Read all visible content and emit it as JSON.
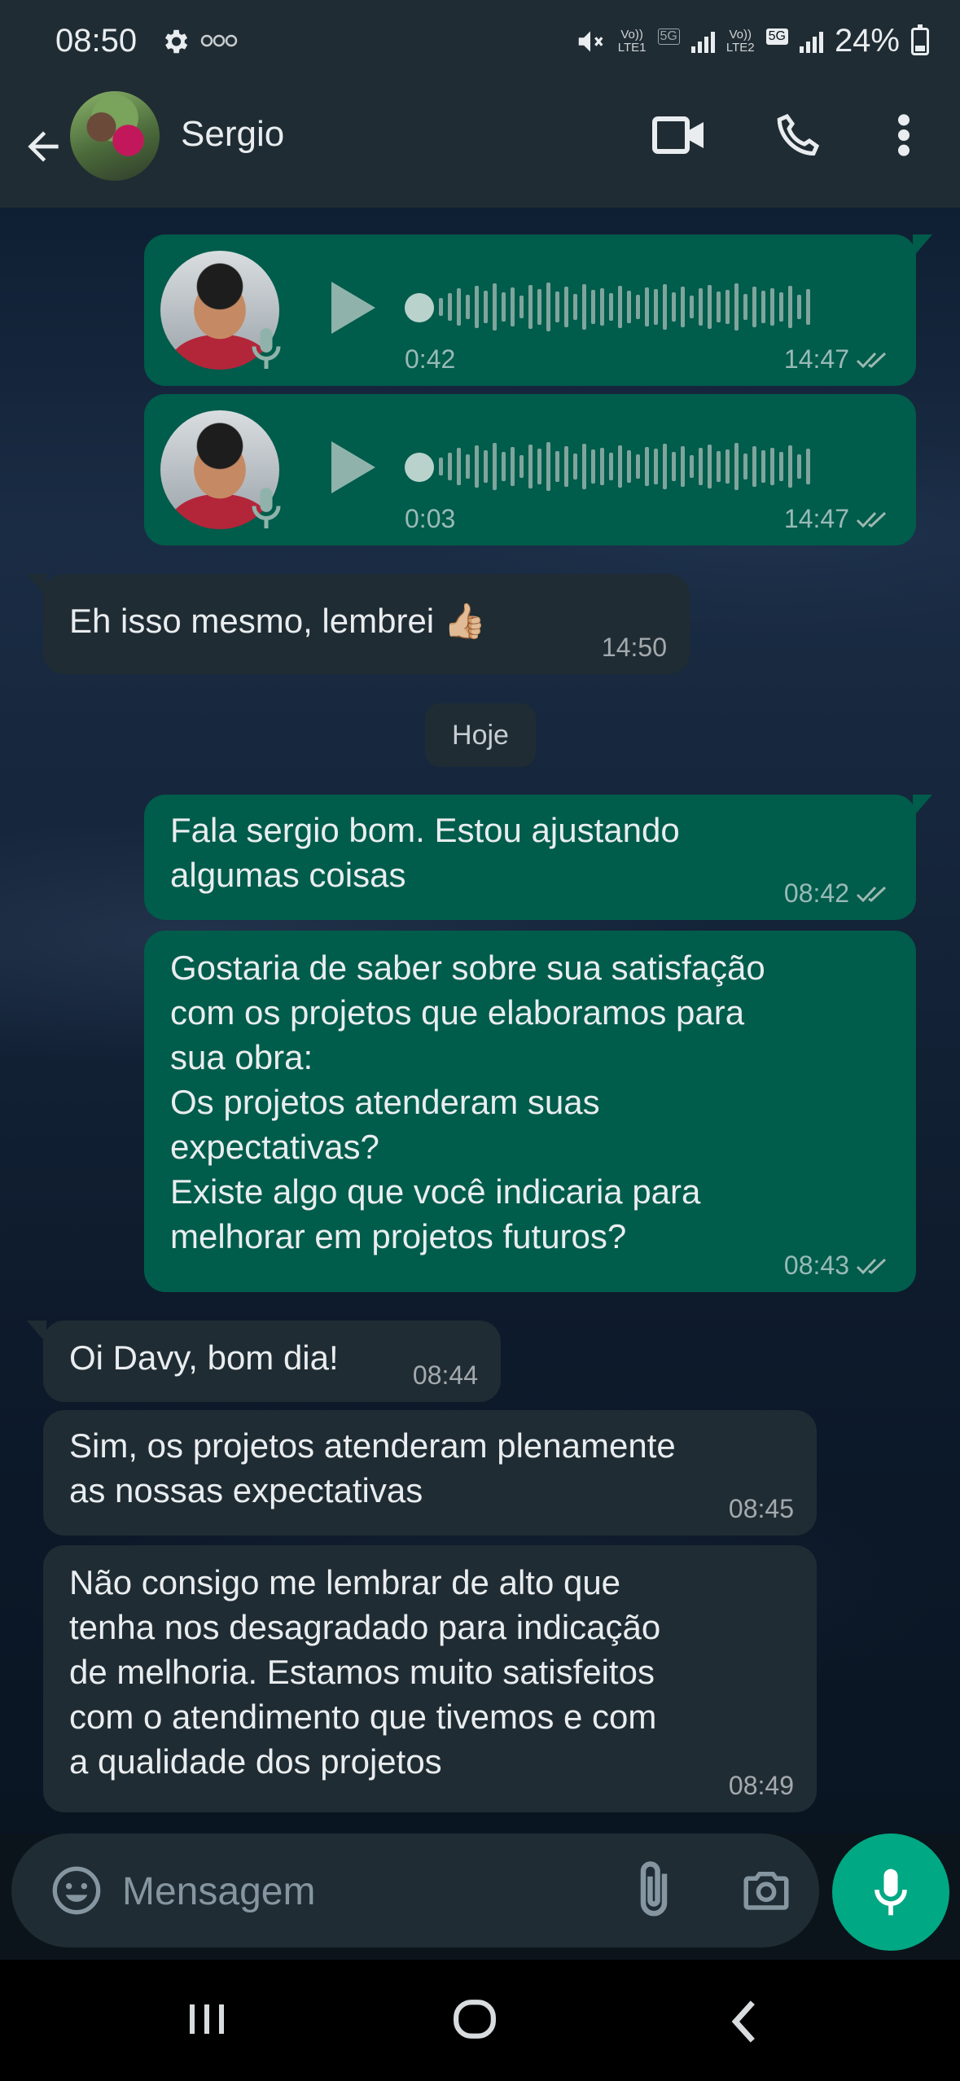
{
  "status_bar": {
    "time": "08:50",
    "icons": [
      "gear-icon",
      "ellipsis-icon",
      "mute-icon",
      "volte1-icon",
      "5g-icon",
      "signal-icon",
      "volte2-icon",
      "5g-icon",
      "signal-icon",
      "battery-icon"
    ],
    "network1_top": "Vo))",
    "network1_bottom": "LTE1",
    "network1_badge": "5G",
    "network2_top": "Vo))",
    "network2_bottom": "LTE2",
    "network2_badge": "5G",
    "battery": "24%"
  },
  "header": {
    "contact_name": "Sergio",
    "icons": [
      "back-arrow-icon",
      "contact-avatar",
      "video-call-icon",
      "phone-icon",
      "more-vert-icon"
    ]
  },
  "messages": [
    {
      "type": "voice",
      "direction": "out",
      "duration": "0:42",
      "time": "14:47",
      "status": "read"
    },
    {
      "type": "voice",
      "direction": "out",
      "duration": "0:03",
      "time": "14:47",
      "status": "read"
    },
    {
      "type": "text",
      "direction": "in",
      "text": "Eh isso mesmo, lembrei 👍🏼",
      "time": "14:50"
    },
    {
      "type": "text",
      "direction": "out",
      "text": "Fala sergio bom. Estou ajustando\nalgumas coisas",
      "time": "08:42",
      "status": "read"
    },
    {
      "type": "text",
      "direction": "out",
      "text": "Gostaria de saber sobre sua satisfação\ncom os projetos que elaboramos para\nsua obra:\nOs projetos atenderam suas\nexpectativas?\nExiste algo que você indicaria para\nmelhorar em projetos futuros?",
      "time": "08:43",
      "status": "read"
    },
    {
      "type": "text",
      "direction": "in",
      "text": "Oi Davy, bom dia!",
      "time": "08:44"
    },
    {
      "type": "text",
      "direction": "in",
      "text": "Sim, os projetos atenderam plenamente\nas nossas expectativas",
      "time": "08:45"
    },
    {
      "type": "text",
      "direction": "in",
      "text": "Não consigo me lembrar de alto que\ntenha nos desagradado para indicação\nde melhoria. Estamos muito satisfeitos\ncom o atendimento que tivemos e com\na qualidade dos projetos",
      "time": "08:49"
    }
  ],
  "date_separator": "Hoje",
  "input": {
    "placeholder": "Mensagem",
    "icons": [
      "emoji-icon",
      "paperclip-icon",
      "camera-icon",
      "microphone-icon"
    ]
  },
  "nav": {
    "icons": [
      "recent-apps-icon",
      "home-icon",
      "back-icon"
    ]
  },
  "colors": {
    "outgoing_bubble": "#005c4b",
    "incoming_bubble": "#202c33",
    "accent": "#00a884",
    "header_bg": "#202c33",
    "read_ticks": "#9fb8b1"
  }
}
